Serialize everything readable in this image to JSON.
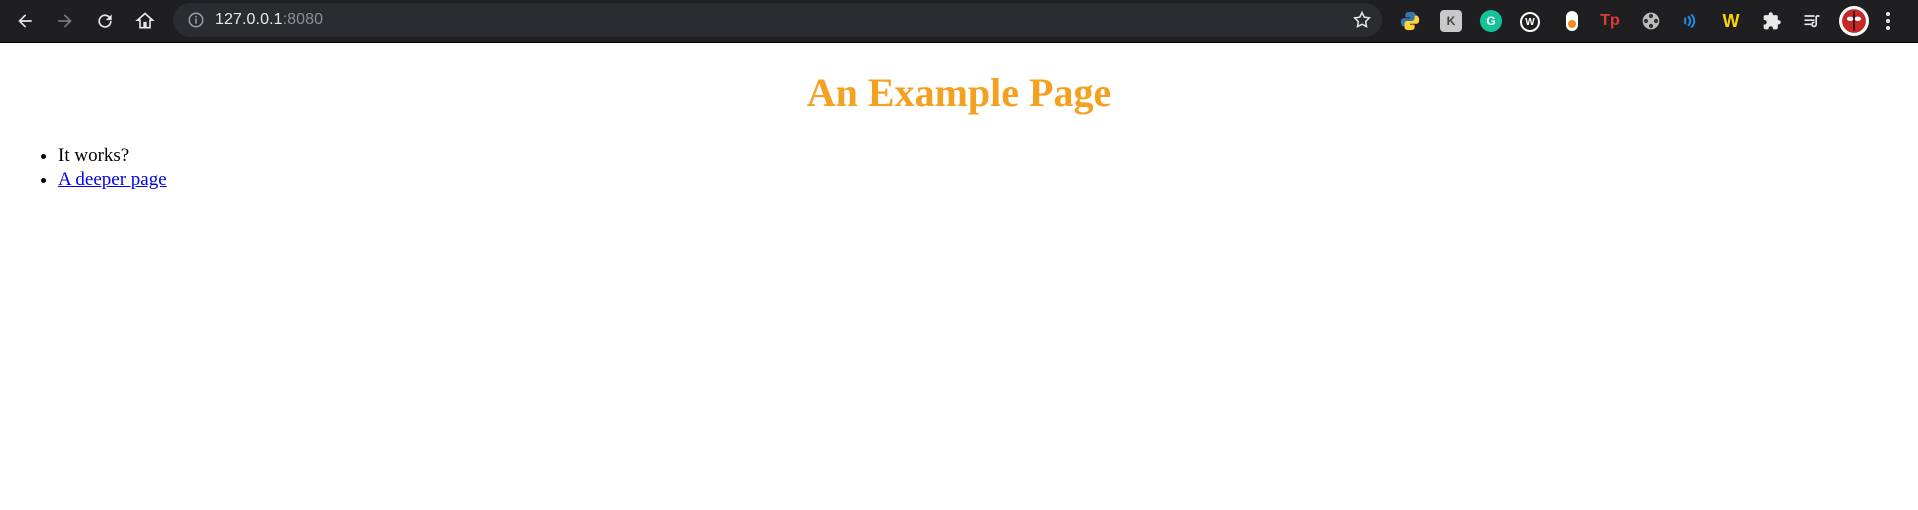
{
  "browser": {
    "url_host": "127.0.0.1",
    "url_port": ":8080",
    "icons": [
      "back-icon",
      "forward-icon",
      "reload-icon",
      "home-icon",
      "site-info-icon",
      "bookmark-star-icon"
    ],
    "extensions": [
      "python-icon",
      "keyboard-extension-icon",
      "grammarly-icon",
      "w-extension-icon",
      "toggle-extension-icon",
      "tp-extension-icon",
      "film-reel-icon",
      "audio-waves-icon",
      "w-colorful-icon",
      "puzzle-extensions-icon",
      "reading-list-icon",
      "profile-avatar",
      "menu-dots-icon"
    ]
  },
  "page": {
    "title": "An Example Page",
    "items": [
      {
        "text": "It works?"
      },
      {
        "text": "A deeper page"
      }
    ]
  },
  "colors": {
    "title": "#f4a020",
    "link": "#0000ee",
    "toolbar": "#1f1f22",
    "omnibox": "#2b2c30"
  }
}
